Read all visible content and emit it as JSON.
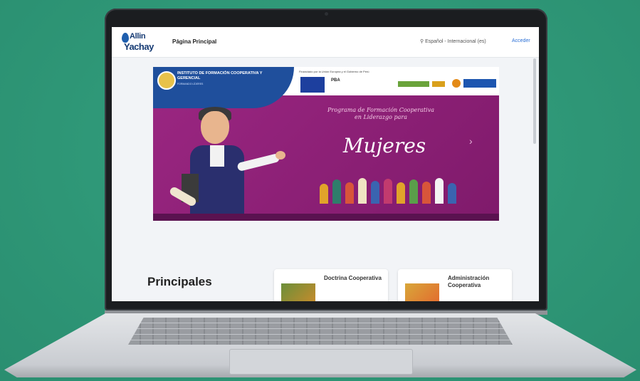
{
  "brand": {
    "line1": "Allin",
    "line2": "Yachay"
  },
  "nav": {
    "home_label": "Página Principal"
  },
  "header": {
    "language": "Español - Internacional (es)",
    "login_label": "Acceder"
  },
  "hero": {
    "institute_line1": "INSTITUTO DE FORMACIÓN COOPERATIVA Y GERENCIAL",
    "institute_line2": "FORMANDO LÍDERES",
    "sponsors_text": "Financiado por la Unión Europea y el Gobierno de Perú",
    "pba_label": "PBA",
    "subtitle": "Programa de Formación Cooperativa en Liderazgo para",
    "title": "Mujeres"
  },
  "section": {
    "title": "Principales",
    "cards": [
      {
        "title": "Doctrina Cooperativa"
      },
      {
        "title": "Administración Cooperativa"
      }
    ]
  },
  "colors": {
    "background": "#2f9a79",
    "hero": "#8c1f74",
    "brand": "#153a73"
  },
  "icons": [
    "droplet-logo-icon",
    "location-pin-icon",
    "chevron-right-icon"
  ]
}
